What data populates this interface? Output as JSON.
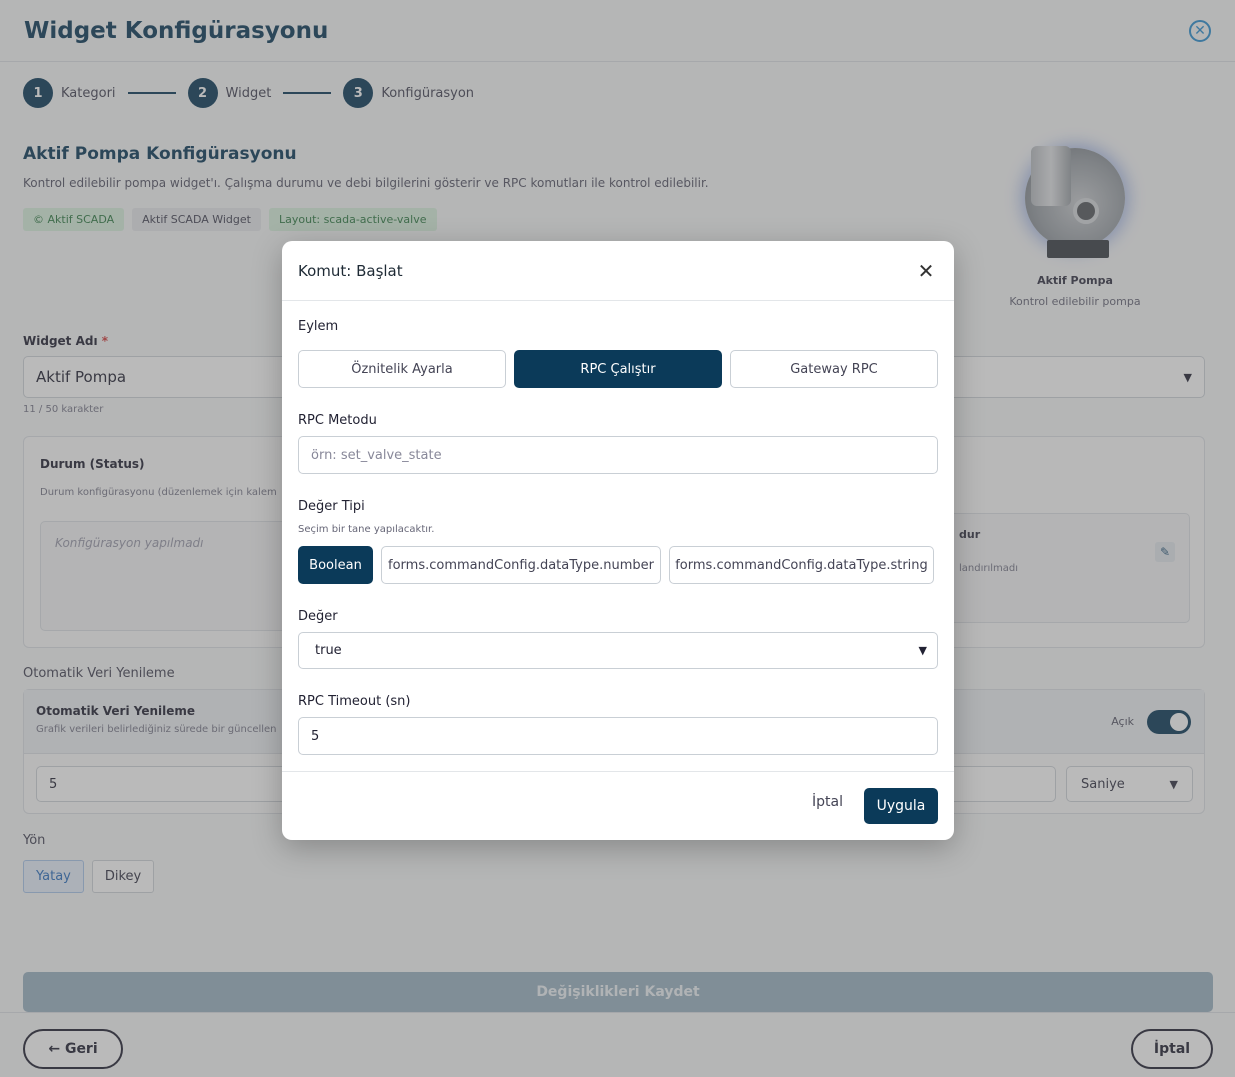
{
  "page": {
    "title": "Widget Konfigürasyonu",
    "close_icon": "close-circle-icon",
    "steps": [
      {
        "number": "1",
        "label": "Kategori"
      },
      {
        "number": "2",
        "label": "Widget"
      },
      {
        "number": "3",
        "label": "Konfigürasyon"
      }
    ],
    "summary": {
      "title": "Aktif Pompa Konfigürasyonu",
      "description": "Kontrol edilebilir pompa widget'ı. Çalışma durumu ve debi bilgilerini gösterir ve RPC komutları ile kontrol edilebilir.",
      "tags": [
        "© Aktif SCADA",
        "Aktif SCADA Widget",
        "Layout: scada-active-valve"
      ]
    },
    "preview": {
      "name": "Aktif Pompa",
      "description": "Kontrol edilebilir pompa"
    },
    "widget_name": {
      "label": "Widget Adı",
      "required_mark": "*",
      "value": "Aktif Pompa",
      "char_count": "11 / 50 karakter"
    },
    "status": {
      "title": "Durum (Status)",
      "hint": "Durum konfigürasyonu (düzenlemek için kalem",
      "empty": "Konfigürasyon yapılmadı",
      "right_title": "dur",
      "right_sub": "landırılmadı"
    },
    "refresh": {
      "section_label": "Otomatik Veri Yenileme",
      "title": "Otomatik Veri Yenileme",
      "hint": "Grafik verileri belirlediğiniz sürede bir güncellen",
      "toggle_label": "Açık",
      "value": "5",
      "unit": "Saniye"
    },
    "direction": {
      "label": "Yön",
      "options": [
        "Yatay",
        "Dikey"
      ],
      "selected": "Yatay"
    },
    "save_label": "Değişiklikleri Kaydet",
    "back_label": "← Geri",
    "cancel_label": "İptal",
    "accent_color": "#0b3a59"
  },
  "modal": {
    "title": "Komut: Başlat",
    "action_label": "Eylem",
    "actions": [
      "Öznitelik Ayarla",
      "RPC Çalıştır",
      "Gateway RPC"
    ],
    "selected_action": "RPC Çalıştır",
    "rpc_method_label": "RPC Metodu",
    "rpc_method_placeholder": "örn: set_valve_state",
    "value_type_label": "Değer Tipi",
    "value_type_hint": "Seçim bir tane yapılacaktır.",
    "value_types": [
      "Boolean",
      "forms.commandConfig.dataType.number",
      "forms.commandConfig.dataType.string"
    ],
    "selected_value_type": "Boolean",
    "value_label": "Değer",
    "value_selected": "true",
    "timeout_label": "RPC Timeout (sn)",
    "timeout_value": "5",
    "cancel_label": "İptal",
    "apply_label": "Uygula"
  }
}
